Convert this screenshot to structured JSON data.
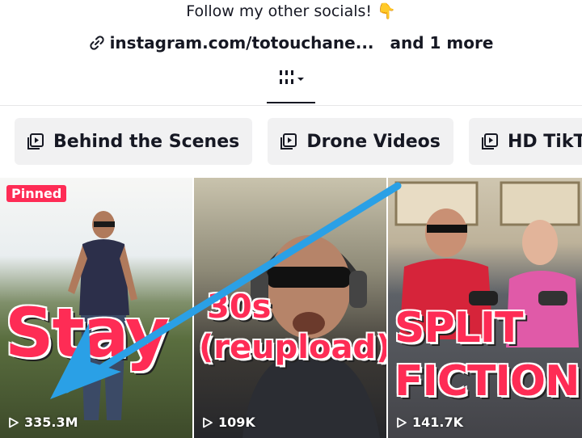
{
  "profile": {
    "bio": "Follow my other socials!",
    "bio_emoji": "👇",
    "link_text": "instagram.com/totouchane...",
    "more_links": "and 1 more"
  },
  "tabs": {
    "active": "grid-icon"
  },
  "playlists": [
    {
      "label": "Behind the Scenes",
      "icon": "playlist-icon"
    },
    {
      "label": "Drone Videos",
      "icon": "playlist-icon"
    },
    {
      "label": "HD TikTok",
      "icon": "playlist-icon"
    }
  ],
  "videos": [
    {
      "badge": "Pinned",
      "overlay": [
        "Stay"
      ],
      "views": "335.3M"
    },
    {
      "overlay": [
        "30s",
        "(reupload)"
      ],
      "views": "109K"
    },
    {
      "overlay": [
        "SPLIT",
        "FICTION"
      ],
      "views": "141.7K"
    }
  ],
  "colors": {
    "accent": "#fe2c55",
    "text": "#161823",
    "chip_bg": "#f1f1f2",
    "annotation_arrow": "#2aa0e6"
  }
}
